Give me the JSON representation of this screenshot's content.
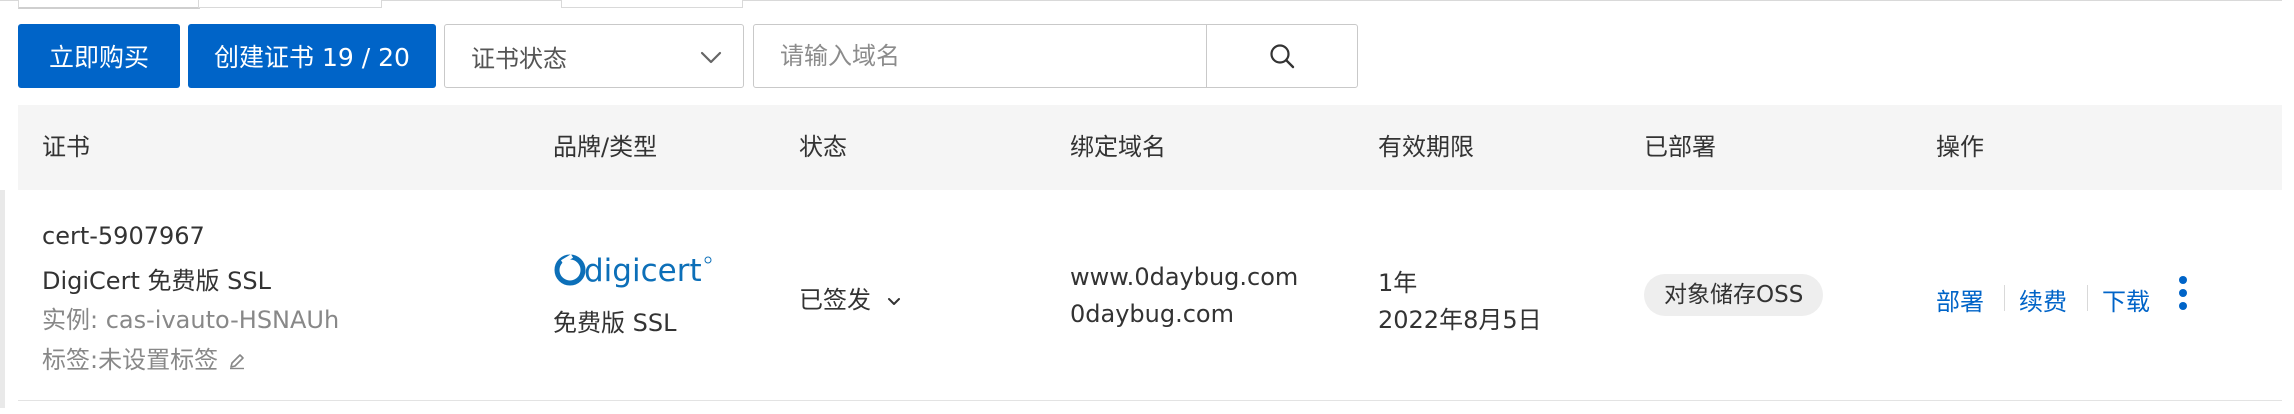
{
  "toolbar": {
    "buy_label": "立即购买",
    "create_label": "创建证书 19 / 20",
    "status_select_value": "证书状态",
    "search_placeholder": "请输入域名"
  },
  "table": {
    "headers": [
      "证书",
      "品牌/类型",
      "状态",
      "绑定域名",
      "有效期限",
      "已部署",
      "操作"
    ],
    "row": {
      "cert_name": "cert-5907967",
      "product": "DigiCert 免费版 SSL",
      "instance": "实例: cas-ivauto-HSNAUh",
      "tags": "标签:未设置标签",
      "brand_logo_text": "digicert",
      "brand_type": "免费版 SSL",
      "status": "已签发",
      "domains": [
        "www.0daybug.com",
        "0daybug.com"
      ],
      "validity": "1年",
      "expiry": "2022年8月5日",
      "deployed": "对象储存OSS",
      "actions": [
        "部署",
        "续费",
        "下载"
      ]
    }
  },
  "colors": {
    "primary": "#0064c8",
    "header_bg": "#f5f5f5",
    "muted_text": "#888888"
  },
  "icons": {
    "search": "search-icon",
    "select_chevron": "chevron-down-icon",
    "status_chevron": "chevron-down-icon",
    "tag_edit": "pencil-icon",
    "more": "more-vertical-icon",
    "brand_logo": "digicert-logo"
  }
}
